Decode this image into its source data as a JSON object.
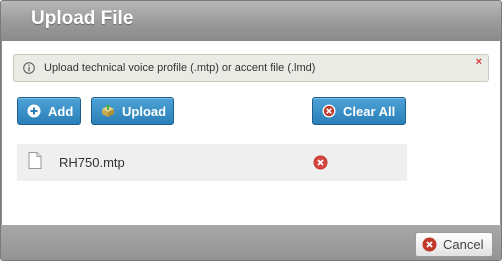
{
  "dialog": {
    "title": "Upload File"
  },
  "info": {
    "message": "Upload technical voice profile (.mtp) or accent file (.lmd)",
    "close_glyph": "×"
  },
  "toolbar": {
    "add_label": "Add",
    "upload_label": "Upload",
    "clear_all_label": "Clear All"
  },
  "files": [
    {
      "name": "RH750.mtp"
    }
  ],
  "footer": {
    "cancel_label": "Cancel"
  },
  "icons": {
    "info": "info-circle-icon",
    "add": "plus-circle-icon",
    "upload": "box-upload-icon",
    "clear": "x-circle-icon",
    "file": "document-icon",
    "remove": "x-circle-icon",
    "cancel": "x-circle-icon"
  },
  "colors": {
    "accent_blue": "#2a7fb8",
    "danger_red": "#c0392b",
    "title_bar": "#9c9c9c"
  }
}
